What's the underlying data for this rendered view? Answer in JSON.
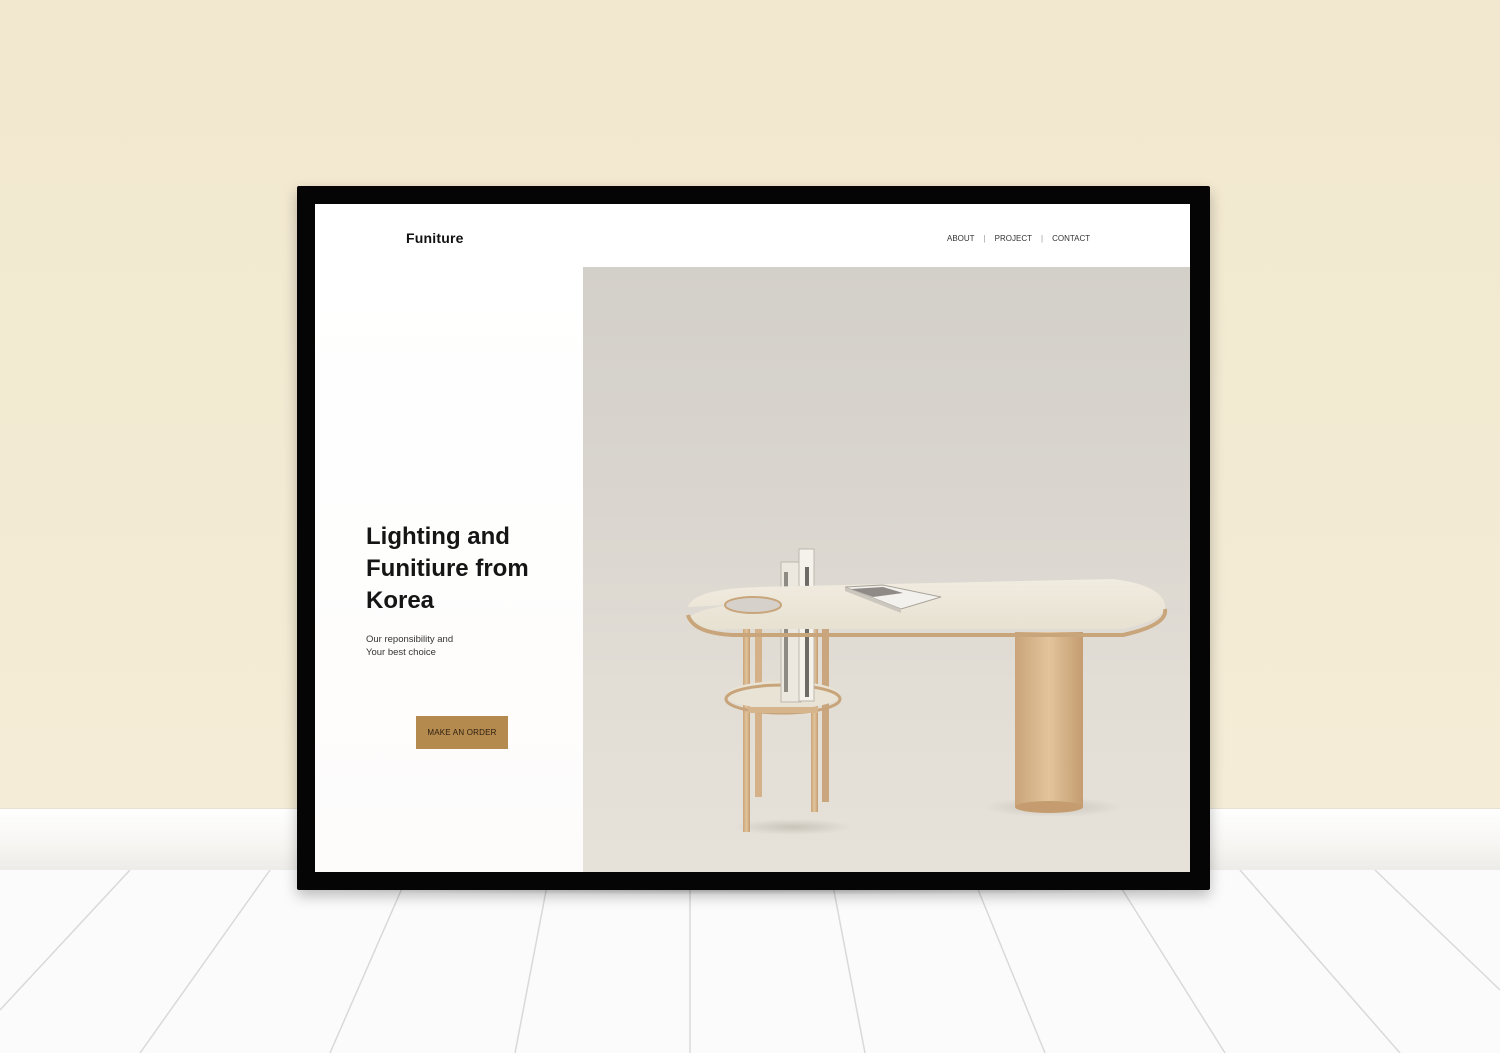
{
  "site": {
    "logo": "Funiture",
    "nav": {
      "items": [
        "ABOUT",
        "PROJECT",
        "CONTACT"
      ],
      "separator": "|"
    },
    "hero": {
      "headline_lines": [
        "Lighting and",
        "Funitiure from",
        "Korea"
      ],
      "subline_lines": [
        "Our reponsibility and",
        "Your best choice"
      ],
      "cta_label": "MAKE AN ORDER",
      "image_subject": "wooden-desk-with-attached-chair-and-books"
    }
  },
  "colors": {
    "wall": "#f2e8cf",
    "frame": "#050505",
    "cta": "#b58a4e",
    "photo_background": "#d8d4cd"
  }
}
